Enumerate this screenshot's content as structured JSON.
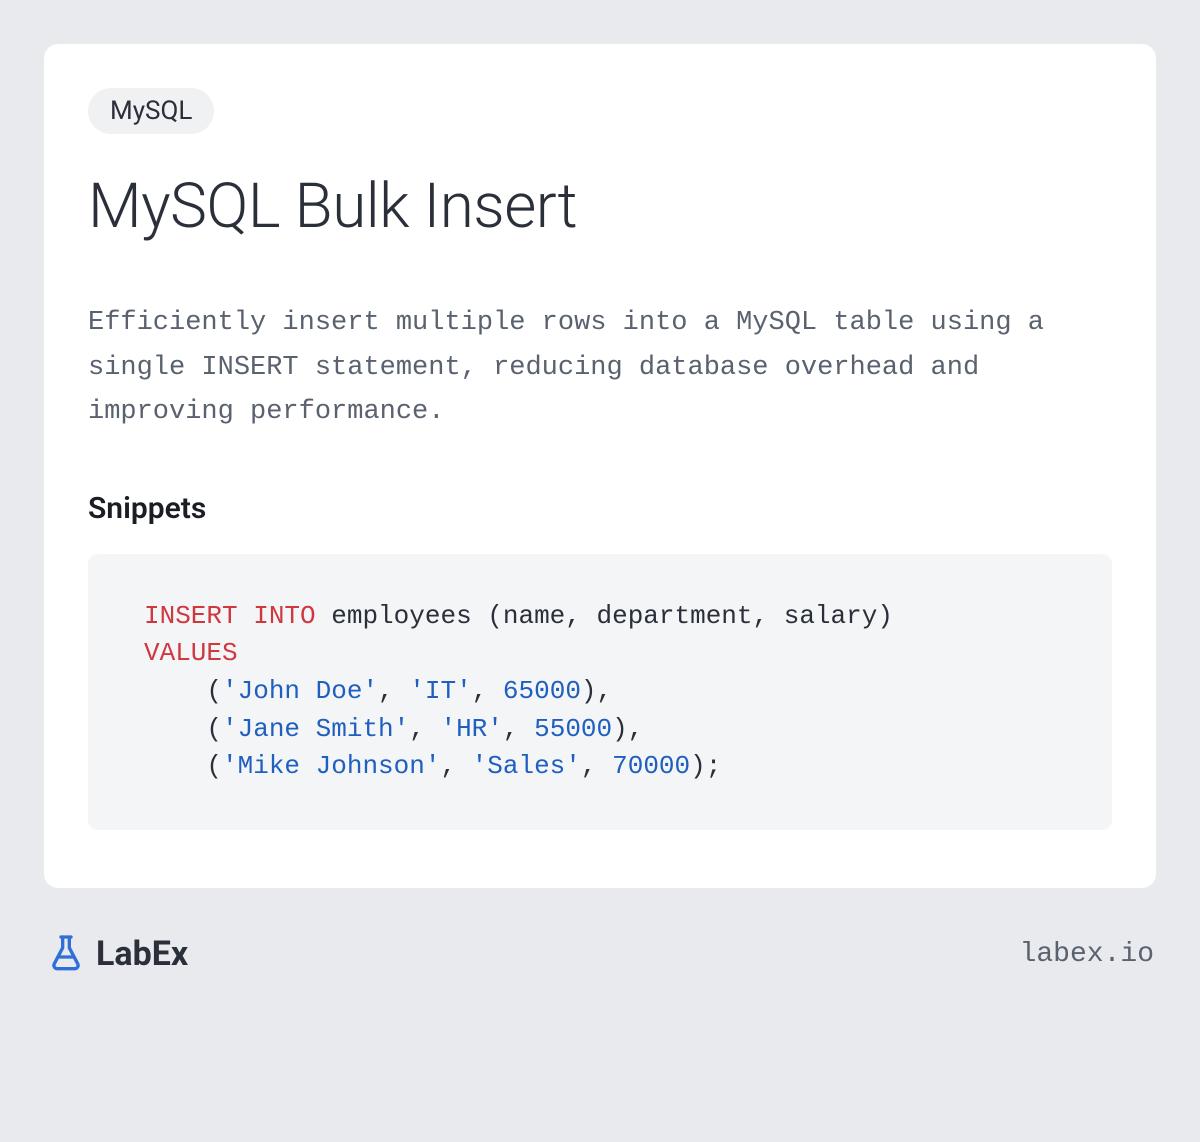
{
  "tag": "MySQL",
  "title": "MySQL Bulk Insert",
  "description": "Efficiently insert multiple rows into a MySQL table using a single INSERT statement, reducing database overhead and improving performance.",
  "snippets_heading": "Snippets",
  "code": {
    "tokens": [
      {
        "type": "kw",
        "text": "INSERT INTO"
      },
      {
        "type": "txt",
        "text": " employees (name, department, salary)\n"
      },
      {
        "type": "kw",
        "text": "VALUES"
      },
      {
        "type": "txt",
        "text": "\n    ("
      },
      {
        "type": "str",
        "text": "'John Doe'"
      },
      {
        "type": "txt",
        "text": ", "
      },
      {
        "type": "str",
        "text": "'IT'"
      },
      {
        "type": "txt",
        "text": ", "
      },
      {
        "type": "num",
        "text": "65000"
      },
      {
        "type": "txt",
        "text": "),\n    ("
      },
      {
        "type": "str",
        "text": "'Jane Smith'"
      },
      {
        "type": "txt",
        "text": ", "
      },
      {
        "type": "str",
        "text": "'HR'"
      },
      {
        "type": "txt",
        "text": ", "
      },
      {
        "type": "num",
        "text": "55000"
      },
      {
        "type": "txt",
        "text": "),\n    ("
      },
      {
        "type": "str",
        "text": "'Mike Johnson'"
      },
      {
        "type": "txt",
        "text": ", "
      },
      {
        "type": "str",
        "text": "'Sales'"
      },
      {
        "type": "txt",
        "text": ", "
      },
      {
        "type": "num",
        "text": "70000"
      },
      {
        "type": "txt",
        "text": ");"
      }
    ]
  },
  "brand": {
    "name": "LabEx",
    "domain": "labex.io"
  }
}
